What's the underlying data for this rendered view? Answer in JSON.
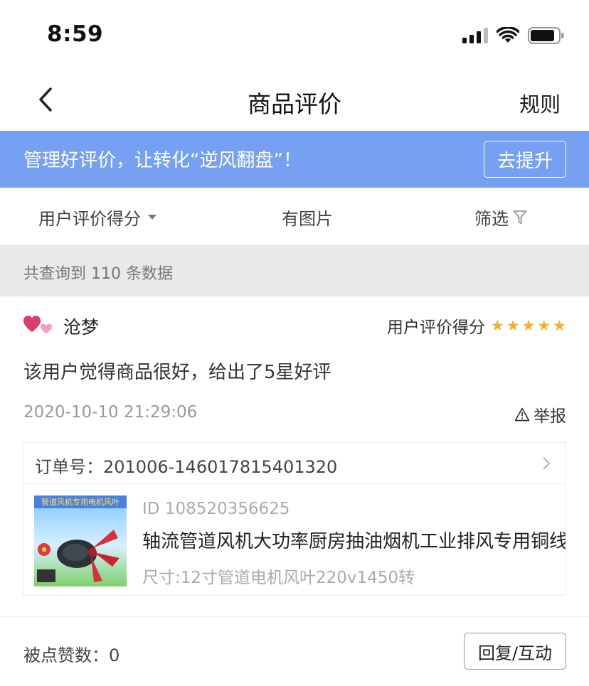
{
  "status_bar": {
    "time": "8:59"
  },
  "nav": {
    "title": "商品评价",
    "rule_label": "规则"
  },
  "banner": {
    "text": "管理好评价，让转化“逆风翻盘”！",
    "button_label": "去提升"
  },
  "filters": {
    "score_label": "用户评价得分",
    "image_label": "有图片",
    "filter_label": "筛选"
  },
  "result": {
    "count_text": "共查询到 110 条数据"
  },
  "review": {
    "username": "沧梦",
    "score_label": "用户评价得分",
    "rating": 5,
    "text": "该用户觉得商品很好，给出了5星好评",
    "time": "2020-10-10 21:29:06",
    "report_label": "举报",
    "order_text": "订单号：201006-146017815401320",
    "product": {
      "id_text": "ID 108520356625",
      "name": "轴流管道风机大功率厨房抽油烟机工业排风专用铜线电机",
      "spec": "尺寸:12寸管道电机风叶220v1450转",
      "image_title": "管道风机专用电机风叶"
    },
    "likes_text": "被点赞数：0",
    "reply_label": "回复/互动"
  },
  "colors": {
    "banner_bg": "#76a0f1",
    "star": "#f3ae2c",
    "count_bg": "#e9e9e9"
  },
  "icons": {
    "back": "chevron-left-icon",
    "filter": "funnel-icon",
    "report": "warning-triangle-icon",
    "avatar": "hearts-icon"
  }
}
